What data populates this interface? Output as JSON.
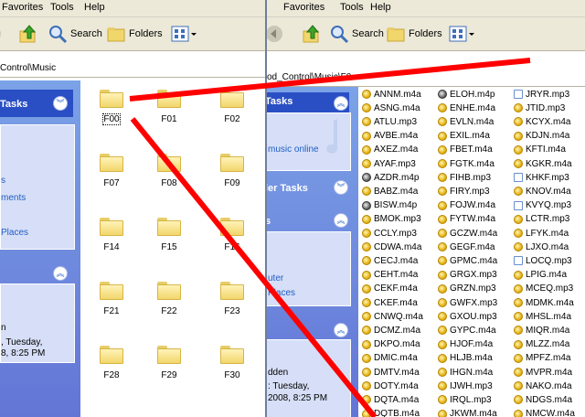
{
  "colors": {
    "taskpane": "#6375d6",
    "link": "#215dc6",
    "redline": "#ff0000",
    "toolbar": "#ece9d8"
  },
  "back_window": {
    "menu": [
      "Favorites",
      "Tools",
      "Help"
    ],
    "toolbar": {
      "search": "Search",
      "folders": "Folders"
    },
    "address": "od_Control\\Music\\F0",
    "taskpane": {
      "tasks_title": "Tasks",
      "music_online": "music online",
      "folder_tasks_title": "ler Tasks",
      "places_title": "s",
      "other_places": [
        "uter",
        "Places"
      ],
      "details": [
        "dden",
        ": Tuesday,",
        "2008, 8:25 PM"
      ]
    },
    "files": {
      "col1": [
        [
          "ANNM.m4a",
          "m4a"
        ],
        [
          "ASNG.m4a",
          "m4a"
        ],
        [
          "ATLU.mp3",
          "mp3"
        ],
        [
          "AVBE.m4a",
          "m4a"
        ],
        [
          "AXEZ.m4a",
          "m4a"
        ],
        [
          "AYAF.mp3",
          "mp3"
        ],
        [
          "AZDR.m4p",
          "m4p"
        ],
        [
          "BABZ.m4a",
          "m4a"
        ],
        [
          "BISW.m4p",
          "m4p"
        ],
        [
          "BMOK.mp3",
          "mp3"
        ],
        [
          "CCLY.mp3",
          "mp3"
        ],
        [
          "CDWA.m4a",
          "m4a"
        ],
        [
          "CECJ.m4a",
          "m4a"
        ],
        [
          "CEHT.m4a",
          "m4a"
        ],
        [
          "CEKF.m4a",
          "m4a"
        ],
        [
          "CKEF.m4a",
          "m4a"
        ],
        [
          "CNWQ.m4a",
          "m4a"
        ],
        [
          "DCMZ.m4a",
          "m4a"
        ],
        [
          "DKPO.m4a",
          "m4a"
        ],
        [
          "DMIC.m4a",
          "m4a"
        ],
        [
          "DMTV.m4a",
          "m4a"
        ],
        [
          "DOTY.m4a",
          "m4a"
        ],
        [
          "DQTA.m4a",
          "m4a"
        ],
        [
          "DQTB.m4a",
          "m4a"
        ]
      ],
      "col2": [
        [
          "ELOH.m4p",
          "m4p"
        ],
        [
          "ENHE.m4a",
          "m4a"
        ],
        [
          "EVLN.m4a",
          "m4a"
        ],
        [
          "EXIL.m4a",
          "m4a"
        ],
        [
          "FBET.m4a",
          "m4a"
        ],
        [
          "FGTK.m4a",
          "m4a"
        ],
        [
          "FIHB.mp3",
          "mp3"
        ],
        [
          "FIRY.mp3",
          "mp3"
        ],
        [
          "FOJW.m4a",
          "m4a"
        ],
        [
          "FYTW.m4a",
          "m4a"
        ],
        [
          "GCZW.m4a",
          "m4a"
        ],
        [
          "GEGF.m4a",
          "m4a"
        ],
        [
          "GPMC.m4a",
          "m4a"
        ],
        [
          "GRGX.mp3",
          "mp3"
        ],
        [
          "GRZN.mp3",
          "mp3"
        ],
        [
          "GWFX.mp3",
          "mp3"
        ],
        [
          "GXOU.mp3",
          "mp3"
        ],
        [
          "GYPC.m4a",
          "m4a"
        ],
        [
          "HJOF.m4a",
          "m4a"
        ],
        [
          "HLJB.m4a",
          "m4a"
        ],
        [
          "IHGN.m4a",
          "m4a"
        ],
        [
          "IJWH.mp3",
          "mp3"
        ],
        [
          "IRQL.mp3",
          "mp3"
        ],
        [
          "JKWM.m4a",
          "m4a"
        ]
      ],
      "col3": [
        [
          "JRYR.mp3",
          "note"
        ],
        [
          "JTID.mp3",
          "mp3"
        ],
        [
          "KCYX.m4a",
          "m4a"
        ],
        [
          "KDJN.m4a",
          "m4a"
        ],
        [
          "KFTI.m4a",
          "m4a"
        ],
        [
          "KGKR.m4a",
          "m4a"
        ],
        [
          "KHKF.mp3",
          "note"
        ],
        [
          "KNOV.m4a",
          "m4a"
        ],
        [
          "KVYQ.mp3",
          "note"
        ],
        [
          "LCTR.mp3",
          "mp3"
        ],
        [
          "LFYK.m4a",
          "m4a"
        ],
        [
          "LJXO.m4a",
          "m4a"
        ],
        [
          "LOCQ.mp3",
          "note"
        ],
        [
          "LPIG.m4a",
          "m4a"
        ],
        [
          "MCEQ.mp3",
          "mp3"
        ],
        [
          "MDMK.m4a",
          "m4a"
        ],
        [
          "MHSL.m4a",
          "m4a"
        ],
        [
          "MIQR.m4a",
          "m4a"
        ],
        [
          "MLZZ.m4a",
          "m4a"
        ],
        [
          "MPFZ.m4a",
          "m4a"
        ],
        [
          "MVPR.m4a",
          "m4a"
        ],
        [
          "NAKO.m4a",
          "m4a"
        ],
        [
          "NDGS.m4a",
          "m4a"
        ],
        [
          "NMCW.m4a",
          "m4a"
        ]
      ]
    }
  },
  "front_window": {
    "menu": [
      "Favorites",
      "Tools",
      "Help"
    ],
    "toolbar": {
      "search": "Search",
      "folders": "Folders"
    },
    "address": "Control\\Music",
    "taskpane": {
      "tasks_title": "Tasks",
      "links": [
        "s",
        "ments",
        "Places"
      ],
      "details": [
        "n",
        ", Tuesday,",
        "8, 8:25 PM"
      ]
    },
    "folders": [
      "F00",
      "F01",
      "F02",
      "F07",
      "F08",
      "F09",
      "F14",
      "F15",
      "F16",
      "F21",
      "F22",
      "F23",
      "F28",
      "F29",
      "F30"
    ]
  }
}
